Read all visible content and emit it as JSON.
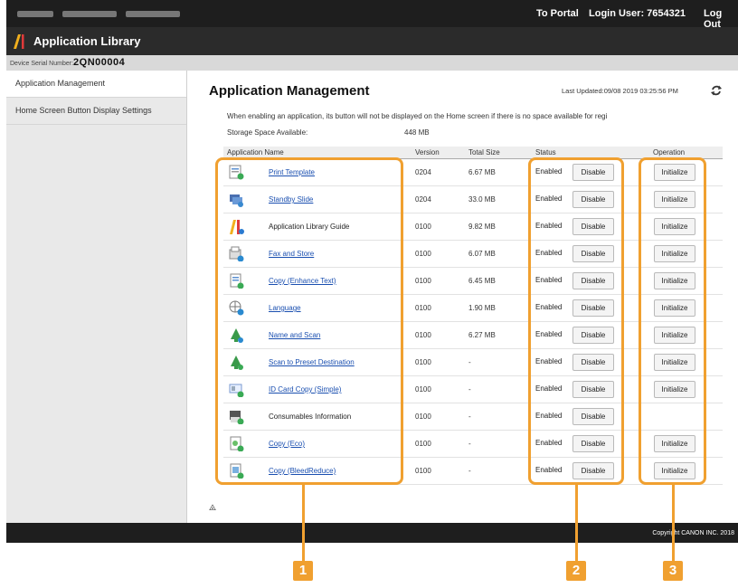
{
  "topbar": {
    "to_portal": "To Portal",
    "login_user": "Login User:  7654321",
    "logout": "Log Out"
  },
  "app": {
    "title": "Application Library"
  },
  "serial": {
    "label": "Device Serial Number:",
    "value": "2QN00004"
  },
  "sidebar": {
    "items": [
      {
        "label": "Application Management"
      },
      {
        "label": "Home Screen Button Display Settings"
      }
    ]
  },
  "main": {
    "title": "Application Management",
    "last_updated": "Last Updated:09/08 2019 03:25:56 PM",
    "notice": "When enabling an application, its button will not be displayed on the Home screen if there is no space available for regi",
    "storage_label": "Storage Space Available:",
    "storage_value": "448 MB"
  },
  "table": {
    "headers": {
      "name": "Application Name",
      "version": "Version",
      "size": "Total Size",
      "status": "Status",
      "operation": "Operation"
    },
    "disable_label": "Disable",
    "initialize_label": "Initialize",
    "rows": [
      {
        "name": "Print Template",
        "version": "0204",
        "size": "6.67 MB",
        "status": "Enabled",
        "icon": "print-template-icon",
        "link": true,
        "initialize": true
      },
      {
        "name": "Standby Slide",
        "version": "0204",
        "size": "33.0 MB",
        "status": "Enabled",
        "icon": "standby-slide-icon",
        "link": true,
        "initialize": true
      },
      {
        "name": "Application Library Guide",
        "version": "0100",
        "size": "9.82 MB",
        "status": "Enabled",
        "icon": "library-guide-icon",
        "link": false,
        "initialize": true
      },
      {
        "name": "Fax and Store",
        "version": "0100",
        "size": "6.07 MB",
        "status": "Enabled",
        "icon": "fax-store-icon",
        "link": true,
        "initialize": true
      },
      {
        "name": "Copy (Enhance Text)",
        "version": "0100",
        "size": "6.45 MB",
        "status": "Enabled",
        "icon": "copy-enhance-icon",
        "link": true,
        "initialize": true
      },
      {
        "name": "Language",
        "version": "0100",
        "size": "1.90 MB",
        "status": "Enabled",
        "icon": "language-icon",
        "link": true,
        "initialize": true
      },
      {
        "name": "Name and Scan",
        "version": "0100",
        "size": "6.27 MB",
        "status": "Enabled",
        "icon": "name-scan-icon",
        "link": true,
        "initialize": true
      },
      {
        "name": "Scan to Preset Destination",
        "version": "0100",
        "size": "-",
        "status": "Enabled",
        "icon": "scan-preset-icon",
        "link": true,
        "initialize": true
      },
      {
        "name": "ID Card Copy (Simple)",
        "version": "0100",
        "size": "-",
        "status": "Enabled",
        "icon": "id-card-copy-icon",
        "link": true,
        "initialize": true
      },
      {
        "name": "Consumables Information",
        "version": "0100",
        "size": "-",
        "status": "Enabled",
        "icon": "consumables-icon",
        "link": false,
        "initialize": false
      },
      {
        "name": "Copy (Eco)",
        "version": "0100",
        "size": "-",
        "status": "Enabled",
        "icon": "copy-eco-icon",
        "link": true,
        "initialize": true
      },
      {
        "name": "Copy (BleedReduce)",
        "version": "0100",
        "size": "-",
        "status": "Enabled",
        "icon": "copy-bleed-icon",
        "link": true,
        "initialize": true
      }
    ]
  },
  "footer": {
    "copyright": "Copyright CANON INC. 2018"
  },
  "callouts": [
    "1",
    "2",
    "3"
  ],
  "colors": {
    "callout": "#f0a030",
    "link": "#1a4fb0",
    "titlebar": "#2b2b2b"
  }
}
